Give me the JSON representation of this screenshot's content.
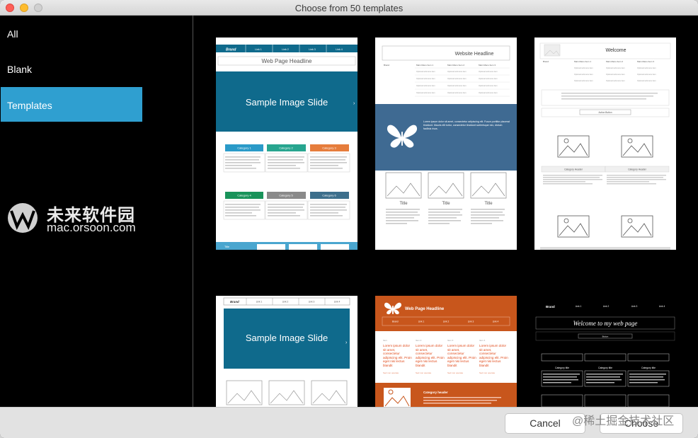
{
  "window": {
    "title": "Choose from 50 templates"
  },
  "sidebar": {
    "items": [
      {
        "label": "All"
      },
      {
        "label": "Blank"
      },
      {
        "label": "Templates",
        "active": true
      }
    ]
  },
  "watermark": {
    "cn": "未来软件园",
    "url": "mac.orsoon.com"
  },
  "corner_watermark": "@稀土掘金技术社区",
  "colors": {
    "accent": "#2f9fd0",
    "teal": "#0f6a8c",
    "steel": "#3f6a92",
    "orange": "#c8561c"
  },
  "templates": {
    "t1": {
      "brand": "Brand",
      "links": [
        "Link 1",
        "Link 2",
        "Link 3",
        "Link 4"
      ],
      "headline": "Web Page Headline",
      "slide": "Sample Image Slide",
      "categories": [
        "Category 1",
        "Category 2",
        "Category 3",
        "Category 4",
        "Category 5",
        "Category 6"
      ],
      "footer": "Title"
    },
    "t2": {
      "headline": "Website Headline",
      "brand": "Brand",
      "menu": [
        "Main Menu Item 1",
        "Main Menu Item 2",
        "Main Menu Item 3"
      ],
      "option": "Optional submenu item",
      "blurb": "Lorem ipsum dolor sit amet, consectetur adipiscing elit. Fusce porttitor placerat tincidunt. Mauris elit tortor, consectetur tincidunt scelerisque nec, dictum facilisis risus.",
      "titles": [
        "Title",
        "Title",
        "Title"
      ]
    },
    "t3": {
      "headline": "Welcome",
      "brand": "Brand",
      "menu": [
        "Main Menu Item 1",
        "Main Menu Item 2",
        "Main Menu Item 3"
      ],
      "option": "Optional submenu item",
      "action": "Action Button",
      "headers": [
        "Category Header",
        "Category Header"
      ]
    },
    "t4": {
      "brand": "Brand",
      "links": [
        "Link 1",
        "Link 2",
        "Link 3",
        "Link 4"
      ],
      "slide": "Sample Image Slide"
    },
    "t5": {
      "headline": "Web Page Headline",
      "brand": "Brand",
      "links": [
        "Link 1",
        "Link 2",
        "Link 3",
        "Link 4"
      ],
      "cols": [
        "Item",
        "Item 2",
        "Item 3",
        "Item 4"
      ],
      "lorem": "Lorem ipsum dolor sit amet, consectetur adipiscing elit. Proin eget nisi lectus blandit pellentesque.",
      "caption": "Sed non operate",
      "section": "Category header"
    },
    "t6": {
      "brand": "Brand",
      "links": [
        "Link 1",
        "Link 2",
        "Link 3",
        "Link 4"
      ],
      "headline": "Welcome to my web page",
      "button": "Button",
      "cats": [
        "Category title",
        "Category title",
        "Category title"
      ]
    }
  },
  "buttons": {
    "cancel": "Cancel",
    "choose": "Choose"
  }
}
